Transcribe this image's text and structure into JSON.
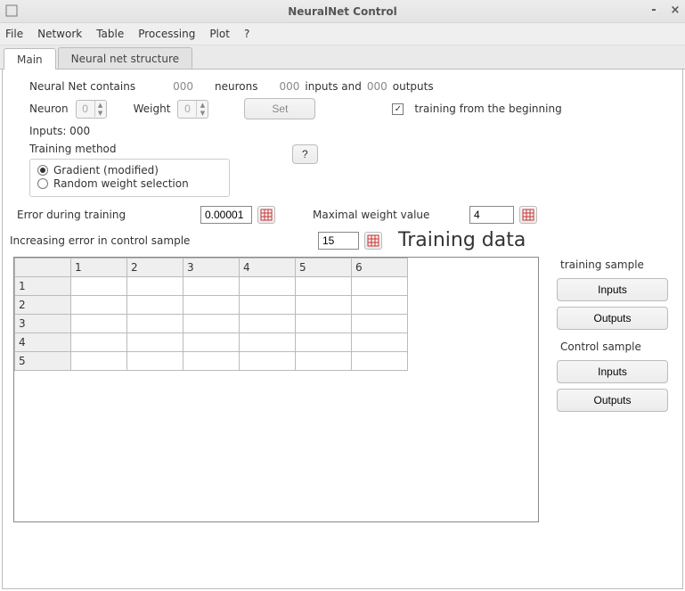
{
  "window": {
    "title": "NeuralNet Control"
  },
  "menu": {
    "file": "File",
    "network": "Network",
    "table": "Table",
    "processing": "Processing",
    "plot": "Plot",
    "help": "?"
  },
  "tabs": {
    "main": "Main",
    "structure": "Neural net structure"
  },
  "nnline": {
    "prefix": "Neural Net contains",
    "neurons_count": "000",
    "neurons_label": "neurons",
    "inputs_count": "000",
    "inputs_label": "inputs and",
    "outputs_count": "000",
    "outputs_label": "outputs"
  },
  "neuron": {
    "label": "Neuron",
    "value": "0"
  },
  "weight": {
    "label": "Weight",
    "value": "0"
  },
  "set_btn": "Set",
  "inputs_line": "Inputs: 000",
  "training_from_beginning": "training from the beginning",
  "training_method": {
    "label": "Training method",
    "opt1": "Gradient (modified)",
    "opt2": "Random weight selection",
    "help": "?"
  },
  "error_training": {
    "label": "Error during training",
    "value": "0.00001"
  },
  "max_weight": {
    "label": "Maximal weight value",
    "value": "4"
  },
  "inc_error": {
    "label": "Increasing error in control sample",
    "value": "15"
  },
  "training_data_heading": "Training data",
  "table": {
    "cols": [
      "1",
      "2",
      "3",
      "4",
      "5",
      "6"
    ],
    "rows": [
      "1",
      "2",
      "3",
      "4",
      "5"
    ]
  },
  "side": {
    "training_sample": "training sample",
    "control_sample": "Control sample",
    "inputs": "Inputs",
    "outputs": "Outputs"
  }
}
